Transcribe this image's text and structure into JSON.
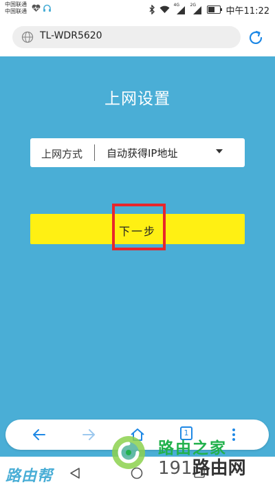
{
  "status_bar": {
    "carrier_1": "中国联通",
    "carrier_2": "中国联通",
    "signal_1": "4G",
    "signal_2": "2G",
    "time": "中午11:22",
    "icons": [
      "heart-icon",
      "headset-icon",
      "bluetooth-icon",
      "wifi-icon",
      "signal-icon",
      "battery-icon"
    ]
  },
  "browser": {
    "url": "TL-WDR5620",
    "icons": [
      "globe-icon",
      "refresh-icon"
    ]
  },
  "page": {
    "title": "上网设置",
    "select": {
      "label": "上网方式",
      "value": "自动获得IP地址"
    },
    "next_button": "下一步",
    "highlight_color": "#e8262b",
    "button_color": "#fff013",
    "background_color": "#4aaed6"
  },
  "toolbar": {
    "icons": [
      "back-arrow-icon",
      "forward-arrow-icon",
      "home-icon",
      "tabs-icon",
      "more-icon"
    ],
    "tabs_count": "1"
  },
  "watermark": {
    "left": "路由帮",
    "right_top": "路由之家",
    "right_bottom_num": "191",
    "right_bottom_text": "路由网"
  }
}
